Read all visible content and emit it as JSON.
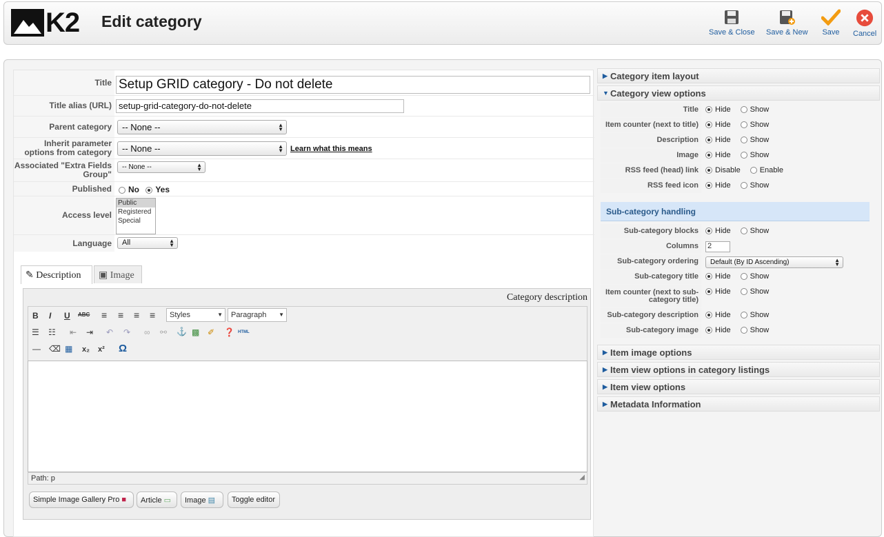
{
  "header": {
    "logo_text": "K2",
    "title": "Edit category",
    "buttons": [
      {
        "label": "Save & Close",
        "icon": "floppy-icon"
      },
      {
        "label": "Save & New",
        "icon": "floppy-plus-icon"
      },
      {
        "label": "Save",
        "icon": "checkmark-icon"
      },
      {
        "label": "Cancel",
        "icon": "cancel-icon"
      }
    ]
  },
  "form": {
    "title_label": "Title",
    "title_value": "Setup GRID category - Do not delete",
    "alias_label": "Title alias (URL)",
    "alias_value": "setup-grid-category-do-not-delete",
    "parent_label": "Parent category",
    "parent_value": "-- None --",
    "inherit_label": "Inherit parameter options from category",
    "inherit_value": "-- None --",
    "inherit_link": "Learn what this means",
    "extra_label": "Associated \"Extra Fields Group\"",
    "extra_value": "-- None --",
    "published_label": "Published",
    "published_no": "No",
    "published_yes": "Yes",
    "access_label": "Access level",
    "access_options": [
      "Public",
      "Registered",
      "Special"
    ],
    "language_label": "Language",
    "language_value": "All"
  },
  "tabs": [
    {
      "label": "Description"
    },
    {
      "label": "Image"
    }
  ],
  "editor": {
    "heading": "Category description",
    "styles": "Styles",
    "format": "Paragraph",
    "path": "Path: p",
    "buttons": [
      "Simple Image Gallery Pro",
      "Article",
      "Image",
      "Toggle editor"
    ]
  },
  "right": {
    "sections_top": [
      "Category item layout",
      "Category view options"
    ],
    "view_options": [
      {
        "label": "Title",
        "a": "Hide",
        "b": "Show"
      },
      {
        "label": "Item counter (next to title)",
        "a": "Hide",
        "b": "Show"
      },
      {
        "label": "Description",
        "a": "Hide",
        "b": "Show"
      },
      {
        "label": "Image",
        "a": "Hide",
        "b": "Show"
      },
      {
        "label": "RSS feed (head) link",
        "a": "Disable",
        "b": "Enable"
      },
      {
        "label": "RSS feed icon",
        "a": "Hide",
        "b": "Show"
      }
    ],
    "sub_header": "Sub-category handling",
    "sub_blocks": {
      "label": "Sub-category blocks",
      "a": "Hide",
      "b": "Show"
    },
    "columns": {
      "label": "Columns",
      "value": "2"
    },
    "ordering": {
      "label": "Sub-category ordering",
      "value": "Default (By ID Ascending)"
    },
    "sub_options": [
      {
        "label": "Sub-category title",
        "a": "Hide",
        "b": "Show"
      },
      {
        "label": "Item counter (next to sub-category title)",
        "a": "Hide",
        "b": "Show"
      },
      {
        "label": "Sub-category description",
        "a": "Hide",
        "b": "Show"
      },
      {
        "label": "Sub-category image",
        "a": "Hide",
        "b": "Show"
      }
    ],
    "sections_bottom": [
      "Item image options",
      "Item view options in category listings",
      "Item view options",
      "Metadata Information"
    ]
  }
}
